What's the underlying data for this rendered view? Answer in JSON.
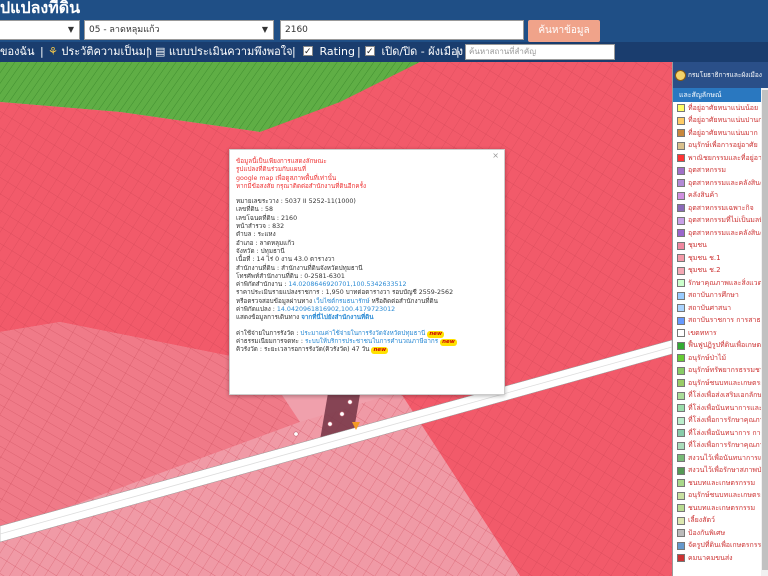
{
  "header": {
    "title": "ปแปลงที่ดิน",
    "province_select": "",
    "district_select": "05 - ลาดหลุมแก้ว",
    "parcel_input": "2160",
    "search_button": "ค้นหาข้อมูล"
  },
  "toolbar": {
    "item1": "ของฉัน",
    "item2": "ประวัติความเป็นมา",
    "item3": "แบบประเมินความพึงพอใจ",
    "item4": "Rating",
    "item5": "เปิด/ปิด - ผังเมือง",
    "place_placeholder": "ค้นหาสถานที่สำคัญ",
    "separator": "|"
  },
  "popup": {
    "close": "×",
    "disclaimer1": "ข้อมูลนี้เป็นเพียงการแสดงลักษณะ",
    "disclaimer2": "รูปแปลงที่ดินร่วมกับแผนที่",
    "disclaimer3": "google map เพื่อดูสภาพพื้นที่เท่านั้น",
    "disclaimer4": "หากมีข้อสงสัย กรุณาติดต่อสำนักงานที่ดินอีกครั้ง",
    "row1": "หมายเลขระวาง : 5037 II 5252-11(1000)",
    "row2": "เลขที่ดิน : 58",
    "row3": "เลขโฉนดที่ดิน : 2160",
    "row4": "หน้าสำรวจ : 832",
    "row5": "ตำบล : ระแหง",
    "row6": "อำเภอ : ลาดหลุมแก้ว",
    "row7": "จังหวัด : ปทุมธานี",
    "row8": "เนื้อที่ : 14 ไร่ 0 งาน 43.0 ตารางวา",
    "row9": "สำนักงานที่ดิน : สำนักงานที่ดินจังหวัดปทุมธานี",
    "row10": "โทรศัพท์สำนักงานที่ดิน : 0-2581-6301",
    "row11_label": "ค่าพิกัดสำนักงาน : ",
    "row11_value": "14.0208646920701,100.5342633512",
    "row12_a": "ราคาประเมินรายแปลงราชการ : 1,950 บาทต่อตารางวา รอบบัญชี 2559-2562",
    "row13_a": "หรือตรวจสอบข้อมูลผ่านทาง ",
    "row13_link": "เว็บไซต์กรมธนารักษ์",
    "row13_b": " หรือติดต่อสำนักงานที่ดิน",
    "row14_label": "ค่าพิกัดแปลง : ",
    "row14_value": "14.0420961816902,100.4179723012",
    "row15_a": "แสดงข้อมูลการเดินทาง ",
    "row15_link": "จากที่นี่ไปยังสำนักงานที่ดิน",
    "row16_a": "ค่าใช้จ่ายในการรังวัด : ",
    "row16_link": "ประมาณค่าใช้จ่ายในการรังวัดจังหวัดปทุมธานี",
    "row17_a": "ค่าธรรมเนียมการจดทะ : ",
    "row17_link": "ระบบให้บริการประชาชนในการคำนวณภาษีอากร",
    "row18": "คิวรังวัด : ระยะเวลารอการรังวัด(คิวรังวัด) 47 วัน",
    "new_badge": "new"
  },
  "side_panel": {
    "header": "กรมโยธาธิการและผังเมือง",
    "subheader": "และสัญลักษณ์",
    "legend": [
      {
        "label": "ที่อยู่อาศัยหนาแน่นน้อย",
        "color": "#ffff66"
      },
      {
        "label": "ที่อยู่อาศัยหนาแน่นปานกลาง",
        "color": "#ffcc66"
      },
      {
        "label": "ที่อยู่อาศัยหนาแน่นมาก",
        "color": "#c8873c"
      },
      {
        "label": "อนุรักษ์เพื่อการอยู่อาศัย",
        "color": "#d9c08c"
      },
      {
        "label": "พาณิชยกรรมและที่อยู่อาศัย",
        "color": "#ff3333"
      },
      {
        "label": "อุตสาหกรรม",
        "color": "#a070c8"
      },
      {
        "label": "อุตสาหกรรมและคลังสินค้า",
        "color": "#b28ad6"
      },
      {
        "label": "คลังสินค้า",
        "color": "#d090e0"
      },
      {
        "label": "อุตสาหกรรมเฉพาะกิจ",
        "color": "#8a6ab8"
      },
      {
        "label": "อุตสาหกรรมที่ไม่เป็นมลพิษ",
        "color": "#c8a0e8"
      },
      {
        "label": "อุตสาหกรรมและคลังสินค้า",
        "color": "#9966cc"
      },
      {
        "label": "ชุมชน",
        "color": "#f088a0"
      },
      {
        "label": "ชุมชน ช.1",
        "color": "#f49aa8"
      },
      {
        "label": "ชุมชน ช.2",
        "color": "#f4a8b4"
      },
      {
        "label": "รักษาคุณภาพและสิ่งแวดล้อม",
        "color": "#ccffcc"
      },
      {
        "label": "สถาบันการศึกษา",
        "color": "#99ccff"
      },
      {
        "label": "สถาบันศาสนา",
        "color": "#aad4ff"
      },
      {
        "label": "สถาบันราชการ การสาธารณูปโภค",
        "color": "#6699ff"
      },
      {
        "label": "เขตทหาร",
        "color": "#ffffff"
      },
      {
        "label": "ฟื้นฟูปฏิรูปที่ดินเพื่อเกษตรกรรม",
        "color": "#33aa33"
      },
      {
        "label": "อนุรักษ์ป่าไม้",
        "color": "#66cc33"
      },
      {
        "label": "อนุรักษ์ทรัพยากรธรรมชาติ",
        "color": "#88cc66"
      },
      {
        "label": "อนุรักษ์ชนบทและเกษตรกรรม",
        "color": "#99cc66"
      },
      {
        "label": "ที่โล่งเพื่อส่งเสริมเอกลักษณ์",
        "color": "#aadd99"
      },
      {
        "label": "ที่โล่งเพื่อนันทนาการและ",
        "color": "#99ddaa"
      },
      {
        "label": "ที่โล่งเพื่อการรักษาคุณภาพ",
        "color": "#bbeecc"
      },
      {
        "label": "ที่โล่งเพื่อนันทนาการ การ",
        "color": "#88ccaa"
      },
      {
        "label": "ที่โล่งเพื่อการรักษาคุณภาพ",
        "color": "#aaddbb"
      },
      {
        "label": "สงวนไว้เพื่อนันทนาการและ",
        "color": "#77bb77"
      },
      {
        "label": "สงวนไว้เพื่อรักษาสภาพป่า",
        "color": "#559955"
      },
      {
        "label": "ชนบทและเกษตรกรรม",
        "color": "#a8d88a"
      },
      {
        "label": "อนุรักษ์ชนบทและเกษตรกรรม",
        "color": "#c8e0a0"
      },
      {
        "label": "ชนบทและเกษตรกรรม",
        "color": "#b8dc90"
      },
      {
        "label": "เลี้ยงสัตว์",
        "color": "#dde8b0"
      },
      {
        "label": "ป้องกันพิเศษ",
        "color": "#bbbbbb"
      },
      {
        "label": "จัดรูปที่ดินเพื่อเกษตรกรรม",
        "color": "#6699cc"
      },
      {
        "label": "คมนาคมขนส่ง",
        "color": "#cc3333"
      }
    ]
  }
}
